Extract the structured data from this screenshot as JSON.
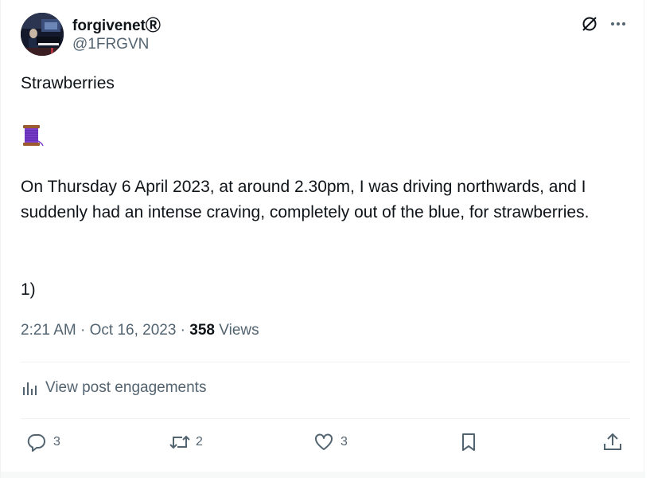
{
  "author": {
    "name": "forgivenetⓇ",
    "handle": "@1FRGVN",
    "avatar_icon": "avatar-pianist-photo"
  },
  "top_actions": {
    "grok_icon": "grok-slash-circle-icon",
    "more_icon": "more-dots-icon"
  },
  "post": {
    "title_line": "Strawberries",
    "emoji_icon": "thread-spool-icon",
    "paragraph_1": "On Thursday 6 April 2023, at around 2.30pm, I was driving northwards, and I suddenly had an intense craving, completely out of the blue, for strawberries.",
    "numbering": "1)"
  },
  "meta": {
    "time": "2:21 AM",
    "separator_1": " · ",
    "date": "Oct 16, 2023",
    "separator_2": " · ",
    "views_count": "358",
    "views_label": " Views"
  },
  "engagements": {
    "label": "View post engagements",
    "icon": "bar-chart-icon"
  },
  "actions": {
    "reply_count": "3",
    "repost_count": "2",
    "like_count": "3",
    "bookmark_icon": "bookmark-icon",
    "share_icon": "share-icon"
  },
  "colors": {
    "text": "#0f1419",
    "muted": "#536471",
    "divider": "#eff3f4",
    "spool": "#7b3fd0"
  }
}
